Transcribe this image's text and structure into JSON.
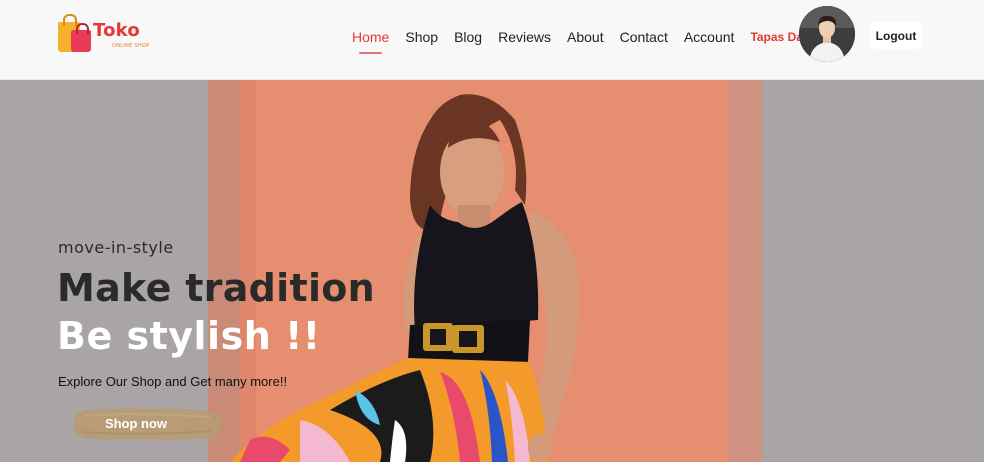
{
  "brand": {
    "name": "Toko",
    "subtitle": "ONLINE SHOP"
  },
  "nav": {
    "items": [
      {
        "label": "Home",
        "active": true
      },
      {
        "label": "Shop",
        "active": false
      },
      {
        "label": "Blog",
        "active": false
      },
      {
        "label": "Reviews",
        "active": false
      },
      {
        "label": "About",
        "active": false
      },
      {
        "label": "Contact",
        "active": false
      },
      {
        "label": "Account",
        "active": false
      }
    ],
    "user_name": "Tapas Dalui",
    "logout_label": "Logout"
  },
  "hero": {
    "kicker": "move-in-style",
    "headline_line1": "Make tradition",
    "headline_line2": "Be stylish !!",
    "tagline": "Explore Our Shop and Get many more!!",
    "cta_label": "Shop now"
  },
  "colors": {
    "accent": "#e53935",
    "cta": "#b89a74",
    "wall": "#e58f70",
    "header_bg": "#f8f8f8"
  }
}
